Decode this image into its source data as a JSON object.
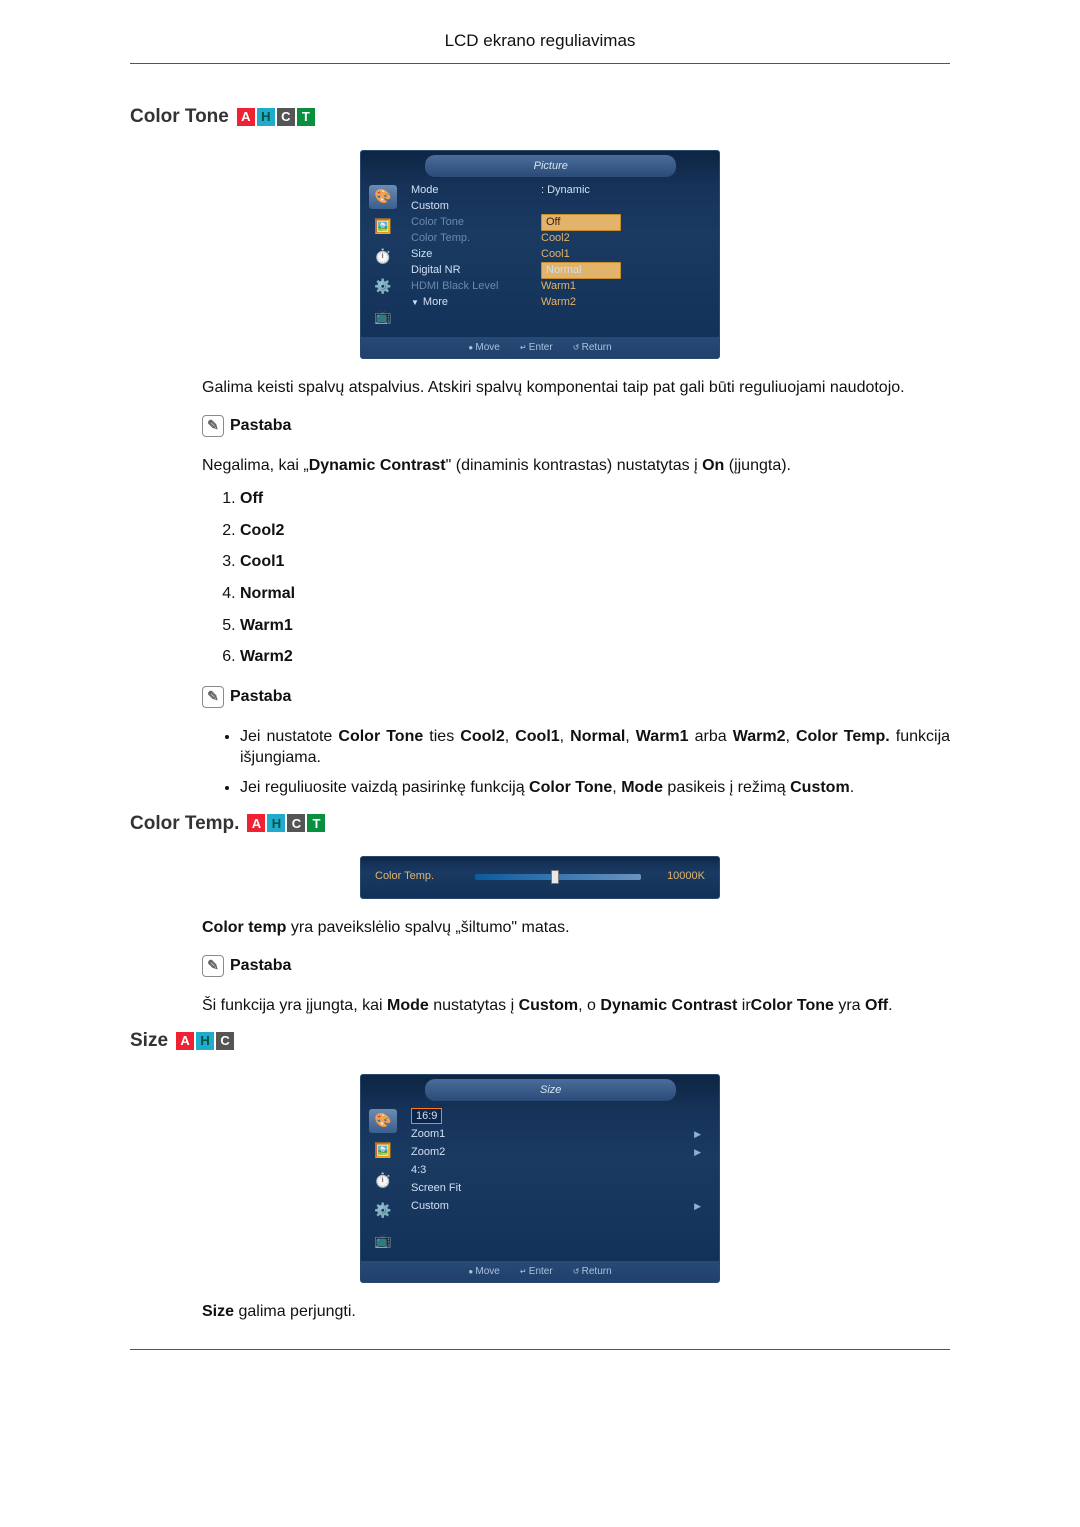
{
  "header": "LCD ekrano reguliavimas",
  "sections": {
    "colorTone": {
      "title": "Color Tone",
      "badges": [
        "A",
        "H",
        "C",
        "T"
      ],
      "osd": {
        "title": "Picture",
        "lines": {
          "mode_lbl": "Mode",
          "mode_val": ": Dynamic",
          "custom_lbl": "Custom",
          "colortone_lbl": "Color Tone",
          "colortone_val": "Off",
          "colortemp_lbl": "Color Temp.",
          "colortemp_val": "Cool2",
          "size_lbl": "Size",
          "size_val": "Cool1",
          "dnr_lbl": "Digital NR",
          "dnr_val": "Normal",
          "hdmi_lbl": "HDMI Black Level",
          "hdmi_val": "Warm1",
          "more_lbl": "More",
          "more_val": "Warm2"
        },
        "footer": {
          "move": "Move",
          "enter": "Enter",
          "return": "Return"
        }
      },
      "intro": "Galima keisti spalvų atspalvius. Atskiri spalvų komponentai taip pat gali būti reguliuojami naudotojo.",
      "noteLabel": "Pastaba",
      "restrict_pre": "Negalima, kai „",
      "restrict_bold": "Dynamic Contrast",
      "restrict_mid": "\" (dinaminis kontrastas) nustatytas į ",
      "restrict_on": "On",
      "restrict_post": " (įjungta).",
      "options": [
        "Off",
        "Cool2",
        "Cool1",
        "Normal",
        "Warm1",
        "Warm2"
      ],
      "note2Label": "Pastaba",
      "bullets": {
        "b1_pre": "Jei nustatote ",
        "b1_b1": "Color Tone",
        "b1_mid1": " ties ",
        "b1_b2": "Cool2",
        "b1_s1": ", ",
        "b1_b3": "Cool1",
        "b1_s2": ", ",
        "b1_b4": "Normal",
        "b1_s3": ", ",
        "b1_b5": "Warm1",
        "b1_mid2": " arba ",
        "b1_b6": "Warm2",
        "b1_s4": ", ",
        "b1_b7": "Color Temp.",
        "b1_post": " funkcija išjungiama.",
        "b2_pre": "Jei reguliuosite vaizdą pasirinkę funkciją ",
        "b2_b1": "Color Tone",
        "b2_mid1": ", ",
        "b2_b2": "Mode",
        "b2_mid2": " pasikeis į režimą ",
        "b2_b3": "Custom",
        "b2_post": "."
      }
    },
    "colorTemp": {
      "title": "Color Temp.",
      "badges": [
        "A",
        "H",
        "C",
        "T"
      ],
      "osd": {
        "label": "Color Temp.",
        "value": "10000K"
      },
      "intro_b": "Color temp",
      "intro_post": " yra paveikslėlio spalvų „šiltumo\" matas.",
      "noteLabel": "Pastaba",
      "cond_pre": "Ši funkcija yra įjungta, kai ",
      "cond_b1": "Mode",
      "cond_mid1": " nustatytas į ",
      "cond_b2": "Custom",
      "cond_mid2": ", o ",
      "cond_b3": "Dynamic Contrast",
      "cond_mid3": " ir",
      "cond_b4": "Color Tone",
      "cond_mid4": " yra ",
      "cond_b5": "Off",
      "cond_post": "."
    },
    "size": {
      "title": "Size",
      "badges": [
        "A",
        "H",
        "C"
      ],
      "osd": {
        "title": "Size",
        "items": [
          "16:9",
          "Zoom1",
          "Zoom2",
          "4:3",
          "Screen Fit",
          "Custom"
        ],
        "footer": {
          "move": "Move",
          "enter": "Enter",
          "return": "Return"
        }
      },
      "intro_b": "Size",
      "intro_post": " galima perjungti."
    }
  }
}
